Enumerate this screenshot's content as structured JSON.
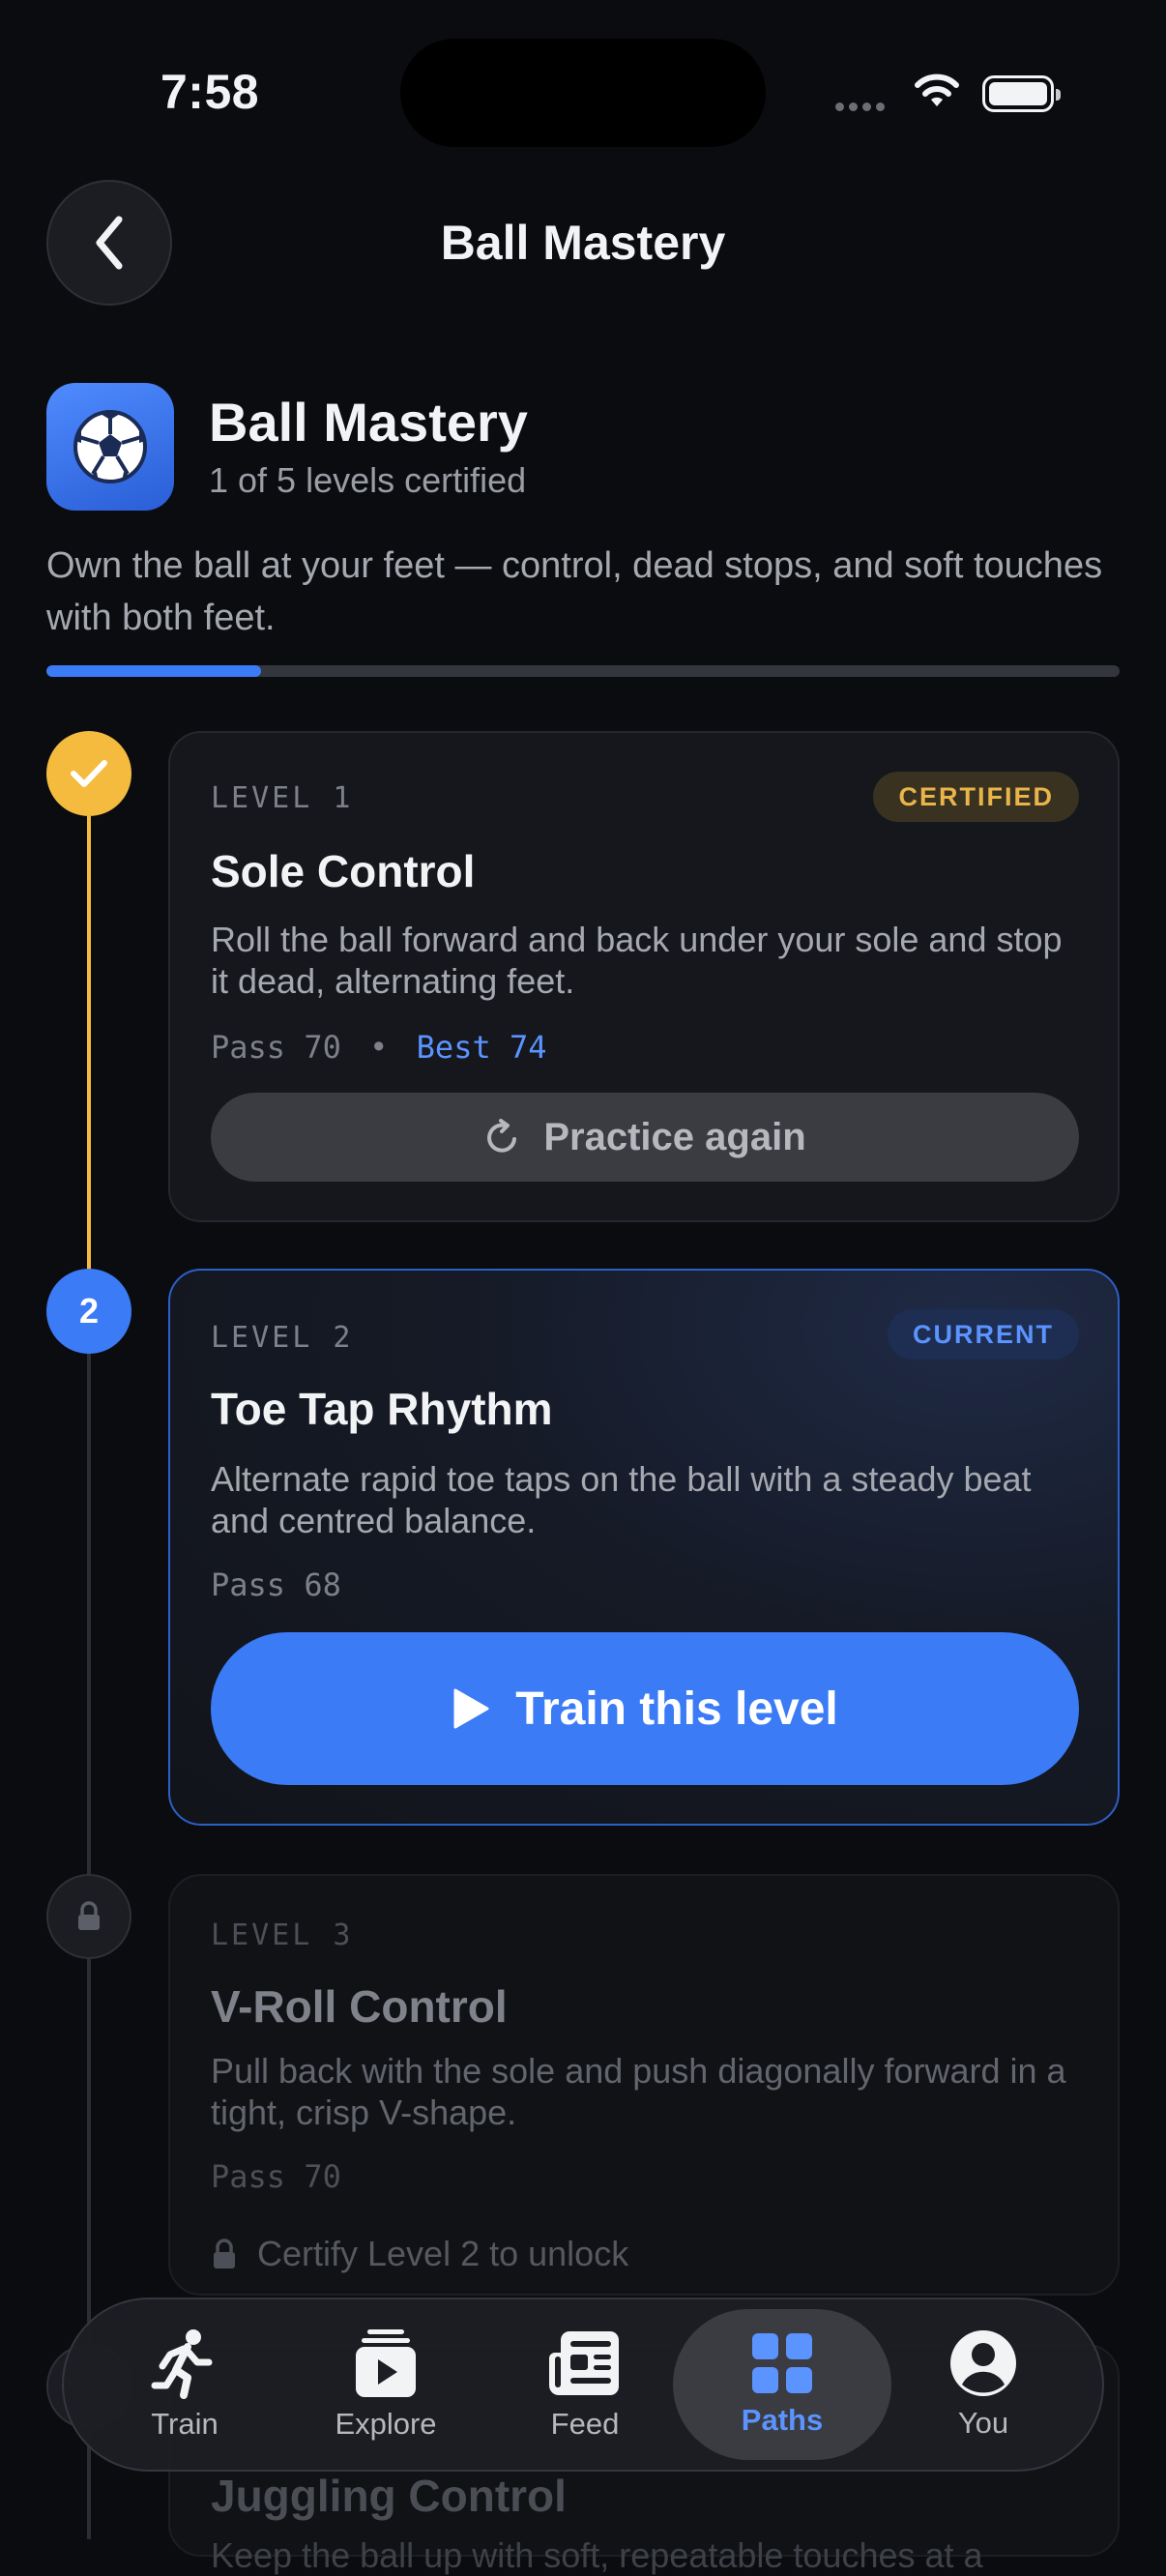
{
  "status_bar": {
    "time": "7:58"
  },
  "header": {
    "title": "Ball Mastery"
  },
  "path": {
    "title": "Ball Mastery",
    "subtitle": "1 of 5 levels certified",
    "description": "Own the ball at your feet — control, dead stops, and soft touches with both feet.",
    "progress_fraction": 0.2,
    "accent_color": "#3b7bf6"
  },
  "levels": [
    {
      "label": "LEVEL 1",
      "title": "Sole Control",
      "badge": "CERTIFIED",
      "description": "Roll the ball forward and back under your sole and stop it dead, alternating feet.",
      "pass": "Pass 70",
      "separator": "•",
      "best": "Best 74",
      "button": "Practice again",
      "status_color": "#f4bb3e"
    },
    {
      "label": "LEVEL 2",
      "node_number": "2",
      "title": "Toe Tap Rhythm",
      "badge": "CURRENT",
      "description": "Alternate rapid toe taps on the ball with a steady beat and centred balance.",
      "pass": "Pass 68",
      "button": "Train this level"
    },
    {
      "label": "LEVEL 3",
      "title": "V-Roll Control",
      "description": "Pull back with the sole and push diagonally forward in a tight, crisp V-shape.",
      "pass": "Pass 70",
      "lock_note": "Certify Level 2 to unlock"
    },
    {
      "title": "Juggling Control",
      "description": "Keep the ball up with soft, repeatable touches at a"
    }
  ],
  "tabs": [
    {
      "label": "Train",
      "icon": "runner-icon"
    },
    {
      "label": "Explore",
      "icon": "play-stack-icon"
    },
    {
      "label": "Feed",
      "icon": "newspaper-icon"
    },
    {
      "label": "Paths",
      "icon": "grid-icon",
      "active": true
    },
    {
      "label": "You",
      "icon": "person-circle-icon"
    }
  ]
}
